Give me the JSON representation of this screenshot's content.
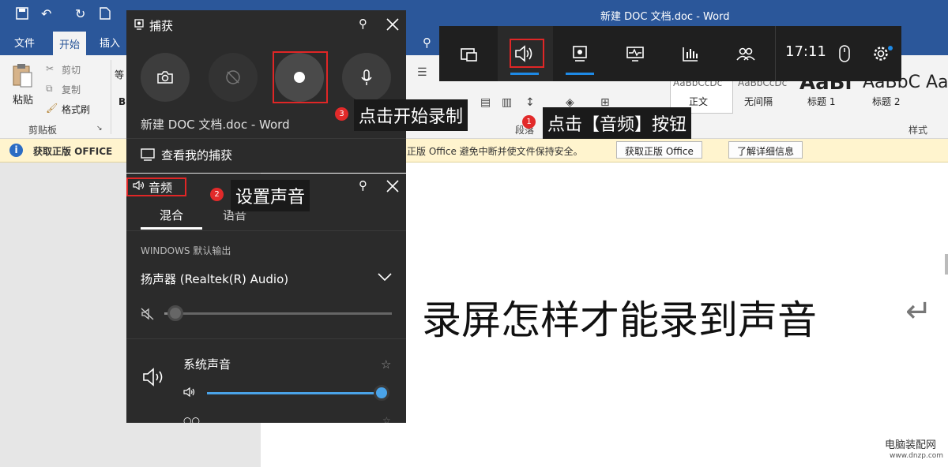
{
  "word": {
    "title": "新建 DOC 文档.doc - Word",
    "tabs": [
      "文件",
      "开始",
      "插入"
    ],
    "clipboard": {
      "paste": "粘贴",
      "cut": "剪切",
      "copy": "复制",
      "painter": "格式刷",
      "group": "剪贴板"
    },
    "paragraph_label": "段落",
    "styles": [
      "正文",
      "无间隔",
      "标题 1",
      "标题 2"
    ],
    "style_previews": [
      "AaBbCcDc",
      "AaBbCcDc",
      "AaBl",
      "AaBbC",
      "Aa"
    ],
    "styles_group": "样式",
    "infobar": {
      "label": "获取正版 OFFICE",
      "message": "正版 Office 避免中断并使文件保持安全。",
      "btn_get": "获取正版 Office",
      "btn_more": "了解详细信息"
    },
    "doc_text": "录屏怎样才能录到声音"
  },
  "gamebar": {
    "time": "17:11"
  },
  "capture": {
    "title": "捕获",
    "window_name": "新建 DOC 文档.doc - Word",
    "view_captures": "查看我的捕获"
  },
  "audio": {
    "title": "音频",
    "tabs": [
      "混合",
      "语音"
    ],
    "section": "WINDOWS 默认输出",
    "device": "扬声器 (Realtek(R) Audio)",
    "master_level": 0.05,
    "app_name": "系统声音",
    "app_level": 0.97
  },
  "annotations": {
    "step1": "点击【音频】按钮",
    "step2": "设置声音",
    "step3": "点击开始录制",
    "n1": "1",
    "n2": "2",
    "n3": "3"
  },
  "watermark": {
    "line1": "电脑装配网",
    "line2": "www.dnzp.com"
  }
}
